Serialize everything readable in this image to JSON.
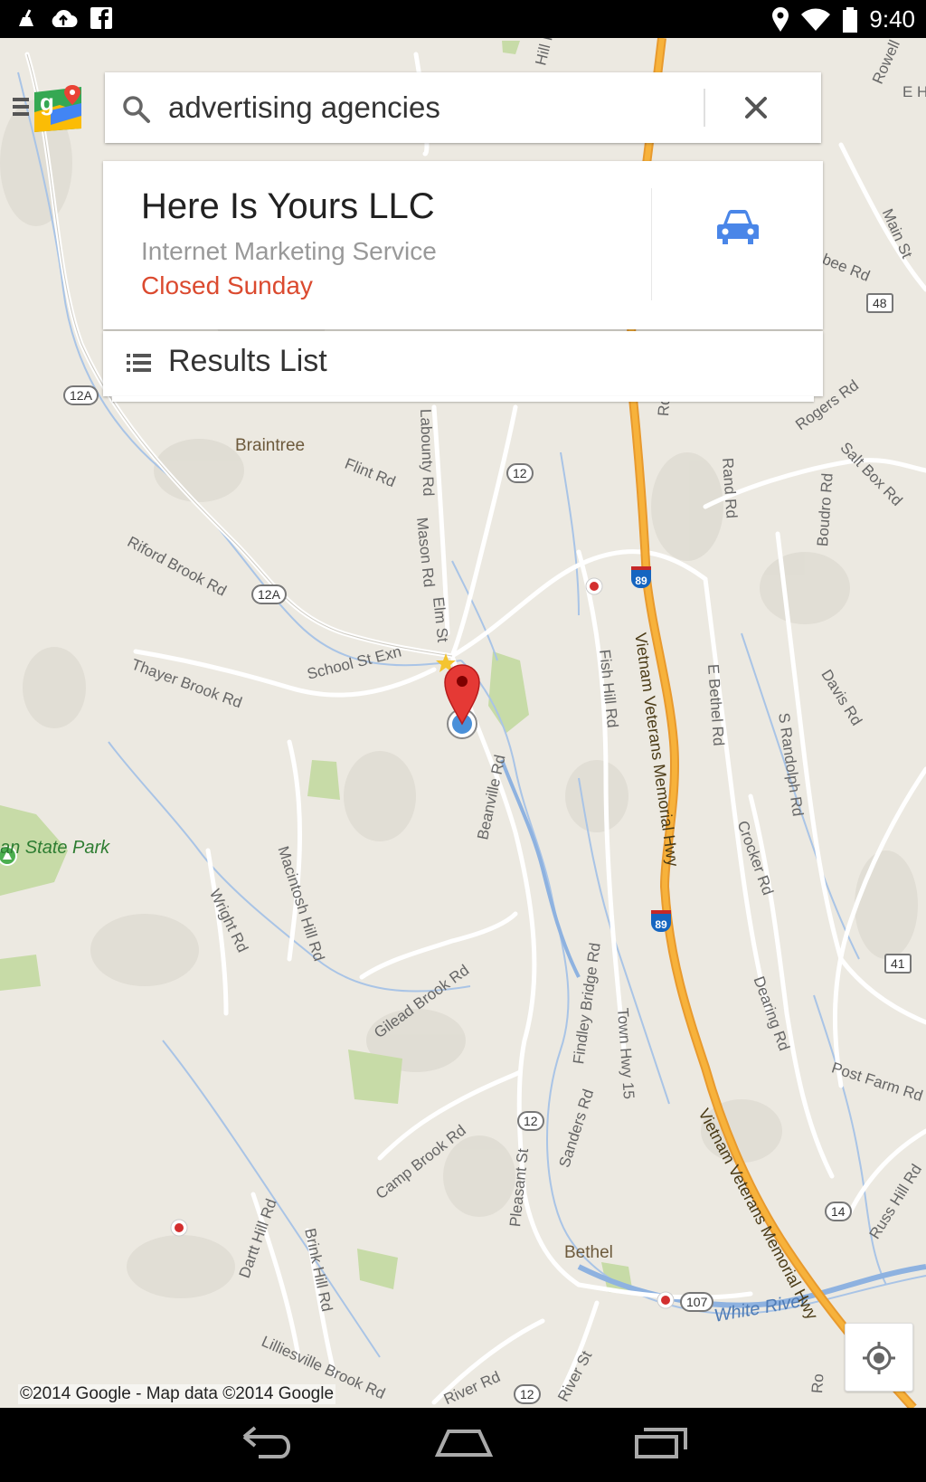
{
  "status_bar": {
    "time": "9:40",
    "left_icons": [
      "cleaner-icon",
      "cloud-upload-icon",
      "facebook-icon"
    ],
    "right_icons": [
      "location-icon",
      "wifi-icon",
      "battery-icon"
    ]
  },
  "search": {
    "query": "advertising agencies",
    "search_icon": "search-icon",
    "clear_icon": "close-icon"
  },
  "menu": {
    "icon": "hamburger-icon",
    "logo": "google-maps-logo"
  },
  "result_card": {
    "title": "Here Is Yours LLC",
    "category": "Internet Marketing Service",
    "hours_status": "Closed Sunday",
    "directions_icon": "car-icon"
  },
  "results_list": {
    "label": "Results List",
    "icon": "list-icon"
  },
  "map": {
    "copyright": "©2014 Google - Map data ©2014 Google",
    "towns": [
      "Braintree",
      "Bethel"
    ],
    "park": "an State Park",
    "river": "White River",
    "roads": [
      "Flint Rd",
      "Labounty Rd",
      "Mason Rd",
      "Elm St",
      "Riford Brook Rd",
      "Thayer Brook Rd",
      "School St Exn",
      "Fish Hill Rd",
      "E Bethel Rd",
      "S Randolph Rd",
      "Davis Rd",
      "Crocker Rd",
      "Beanville Rd",
      "Macintosh Hill Rd",
      "Wright Rd",
      "Gilead Brook Rd",
      "Findley Bridge Rd",
      "Town Hwy 15",
      "Dearing Rd",
      "Post Farm Rd",
      "Camp Brook Rd",
      "Pleasant St",
      "Sanders Rd",
      "Dartt Hill Rd",
      "Brink Hill Rd",
      "Lilliesville Brook Rd",
      "River Rd",
      "River St",
      "Russ Hill Rd",
      "Rand Rd",
      "Rogers Rd",
      "Salt Box Rd",
      "Boudro Rd",
      "Hill Rd",
      "Main St",
      "Rowell",
      "E H",
      "bee Rd",
      "Rd",
      "Ro"
    ],
    "highway": "Vietnam Veterans Memorial Hwy",
    "route_shields": [
      "12A",
      "12A",
      "12",
      "12",
      "12",
      "48",
      "41",
      "14",
      "107"
    ],
    "interstate_shields": [
      "89",
      "89"
    ],
    "locate_icon": "my-location-icon"
  },
  "nav_bar": {
    "back": "back-icon",
    "home": "home-icon",
    "recents": "recents-icon"
  }
}
